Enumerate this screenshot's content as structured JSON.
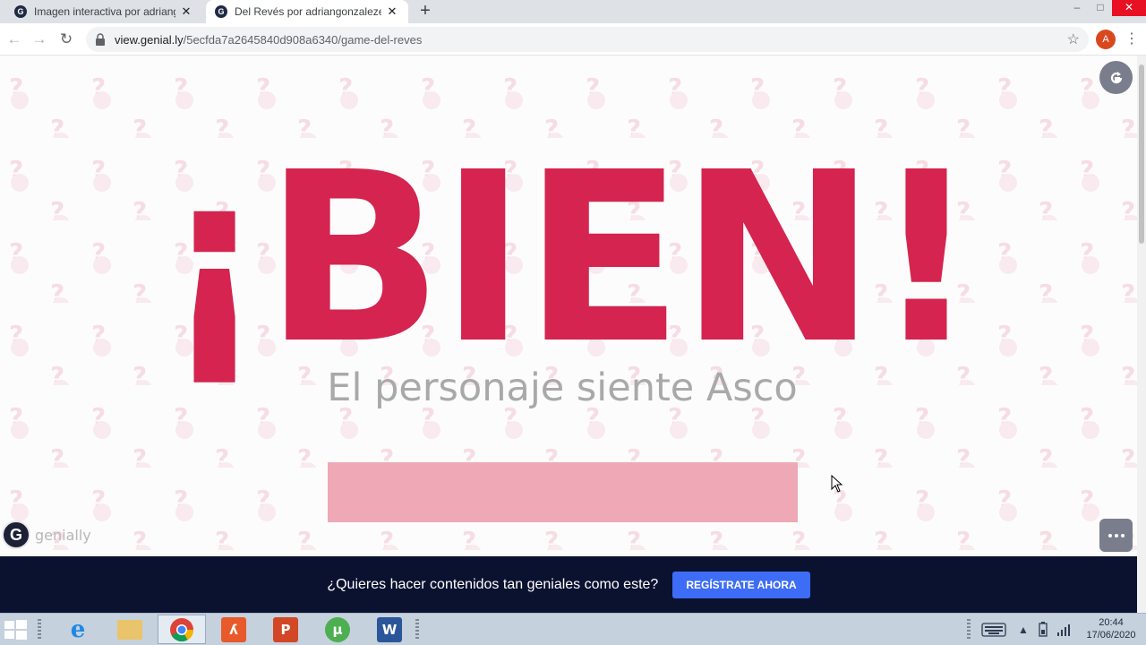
{
  "browser": {
    "tabs": [
      {
        "title": "Imagen interactiva por adriangonz",
        "active": false
      },
      {
        "title": "Del Revés por adriangonzalezesp",
        "active": true
      }
    ],
    "url_host": "view.genial.ly",
    "url_path": "/5ecfda7a2645840d908a6340/game-del-reves",
    "profile_initial": "A",
    "favicon_letter": "G"
  },
  "page": {
    "heading": "¡BIEN!",
    "subtitle": "El personaje siente Asco",
    "brand_logo_text": "genially",
    "colors": {
      "heading": "#d4244f",
      "subtitle": "#a9a9a9",
      "bar": "#eea8b6",
      "banner": "#0b1230",
      "cta": "#3d6cf6"
    }
  },
  "banner": {
    "text": "¿Quieres hacer contenidos tan geniales como este?",
    "cta_label": "REGÍSTRATE AHORA"
  },
  "taskbar": {
    "apps": [
      "internet-explorer",
      "file-explorer",
      "chrome",
      "acrobat",
      "powerpoint",
      "utorrent",
      "word"
    ],
    "time": "20:44",
    "date": "17/06/2020"
  }
}
